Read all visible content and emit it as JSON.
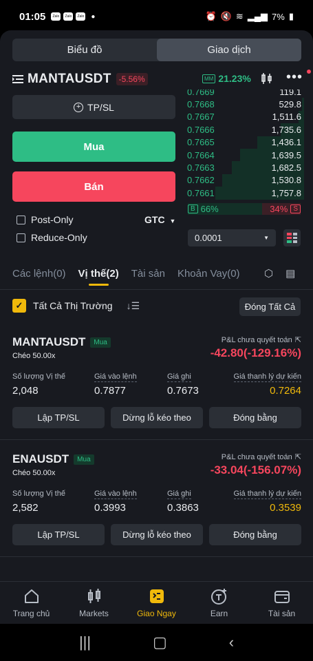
{
  "status_bar": {
    "time": "01:05",
    "apps": [
      "Zalo",
      "Zalo",
      "Zalo"
    ],
    "battery": "7%"
  },
  "segmented": {
    "chart": "Biểu đồ",
    "trade": "Giao dịch"
  },
  "pair": {
    "symbol": "MANTAUSDT",
    "change": "-5.56%",
    "mm_label": "MM",
    "mm_value": "21.23%"
  },
  "order_form": {
    "tpsl_label": "TP/SL",
    "buy_label": "Mua",
    "sell_label": "Bán",
    "post_only": "Post-Only",
    "reduce_only": "Reduce-Only",
    "tif": "GTC"
  },
  "orderbook": {
    "rows": [
      {
        "price": "0.7669",
        "qty": "119.1",
        "depth": 0.0
      },
      {
        "price": "0.7668",
        "qty": "529.8",
        "depth": 0.02
      },
      {
        "price": "0.7667",
        "qty": "1,511.6",
        "depth": 0.05
      },
      {
        "price": "0.7666",
        "qty": "1,735.6",
        "depth": 0.2
      },
      {
        "price": "0.7665",
        "qty": "1,436.1",
        "depth": 0.4
      },
      {
        "price": "0.7664",
        "qty": "1,639.5",
        "depth": 0.55
      },
      {
        "price": "0.7663",
        "qty": "1,682.5",
        "depth": 0.62
      },
      {
        "price": "0.7662",
        "qty": "1,530.8",
        "depth": 0.7
      },
      {
        "price": "0.7661",
        "qty": "1,757.8",
        "depth": 0.76
      }
    ],
    "buy_tag": "B",
    "buy_pct": "66%",
    "sell_pct": "34%",
    "sell_tag": "S",
    "precision": "0.0001"
  },
  "tabs": {
    "orders": "Các lệnh(0)",
    "positions": "Vị thế(2)",
    "assets": "Tài sản",
    "loans": "Khoản Vay(0)"
  },
  "filter": {
    "all_markets": "Tất Cả Thị Trường",
    "close_all": "Đóng Tất Cả"
  },
  "positions": [
    {
      "symbol": "MANTAUSDT",
      "side": "Mua",
      "margin": "Chéo 50.00x",
      "pnl_label": "P&L chưa quyết toán",
      "pnl": "-42.80(-129.16%)",
      "size_label": "Số lượng Vị thế",
      "size": "2,048",
      "entry_label": "Giá vào lệnh",
      "entry": "0.7877",
      "mark_label": "Giá ghi",
      "mark": "0.7673",
      "liq_label": "Giá thanh lý dự kiến",
      "liq": "0.7264",
      "btn_tpsl": "Lập TP/SL",
      "btn_trailing": "Dừng lỗ kéo theo",
      "btn_close": "Đóng bằng"
    },
    {
      "symbol": "ENAUSDT",
      "side": "Mua",
      "margin": "Chéo 50.00x",
      "pnl_label": "P&L chưa quyết toán",
      "pnl": "-33.04(-156.07%)",
      "size_label": "Số lượng Vị thế",
      "size": "2,582",
      "entry_label": "Giá vào lệnh",
      "entry": "0.3993",
      "mark_label": "Giá ghi",
      "mark": "0.3863",
      "liq_label": "Giá thanh lý dự kiến",
      "liq": "0.3539",
      "btn_tpsl": "Lập TP/SL",
      "btn_trailing": "Dừng lỗ kéo theo",
      "btn_close": "Đóng bằng"
    }
  ],
  "bottom_nav": [
    {
      "label": "Trang chủ",
      "icon": "home-icon"
    },
    {
      "label": "Markets",
      "icon": "candlestick-icon"
    },
    {
      "label": "Giao Ngay",
      "icon": "trade-icon"
    },
    {
      "label": "Earn",
      "icon": "earn-icon"
    },
    {
      "label": "Tài sản",
      "icon": "wallet-icon"
    }
  ],
  "colors": {
    "green": "#2ebd85",
    "red": "#f6465d",
    "yellow": "#f0b90b",
    "bg": "#181a20"
  }
}
